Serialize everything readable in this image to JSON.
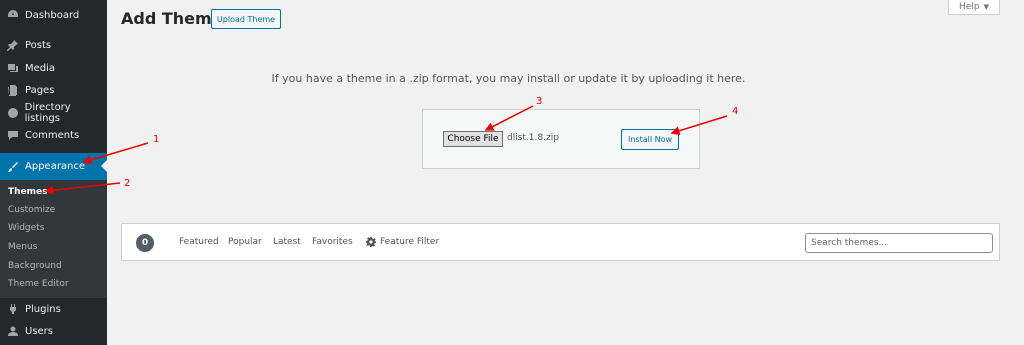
{
  "sidebar": {
    "items": [
      {
        "label": "Dashboard",
        "icon": "dashboard-icon"
      },
      {
        "label": "Posts",
        "icon": "pin-icon"
      },
      {
        "label": "Media",
        "icon": "media-icon"
      },
      {
        "label": "Pages",
        "icon": "pages-icon"
      },
      {
        "label": "Directory listings",
        "icon": "directory-icon"
      },
      {
        "label": "Comments",
        "icon": "comment-icon"
      },
      {
        "label": "Appearance",
        "icon": "brush-icon"
      },
      {
        "label": "Plugins",
        "icon": "plugin-icon"
      },
      {
        "label": "Users",
        "icon": "user-icon"
      }
    ],
    "submenu": [
      "Themes",
      "Customize",
      "Widgets",
      "Menus",
      "Background",
      "Theme Editor"
    ]
  },
  "header": {
    "title": "Add Themes",
    "upload_label": "Upload Theme",
    "help_label": "Help"
  },
  "upload": {
    "message": "If you have a theme in a .zip format, you may install or update it by uploading it here.",
    "choose_file_label": "Choose File",
    "file_name": "dlist.1.8.zip",
    "install_label": "Install Now"
  },
  "filter": {
    "count": "0",
    "links": [
      "Featured",
      "Popular",
      "Latest",
      "Favorites"
    ],
    "feature_filter_label": "Feature Filter",
    "search_placeholder": "Search themes..."
  },
  "annotations": {
    "labels": [
      "1",
      "2",
      "3",
      "4"
    ],
    "color": "#e00000"
  },
  "colors": {
    "sidebar_bg": "#23282d",
    "active_bg": "#0073aa",
    "accent": "#0071a1"
  }
}
